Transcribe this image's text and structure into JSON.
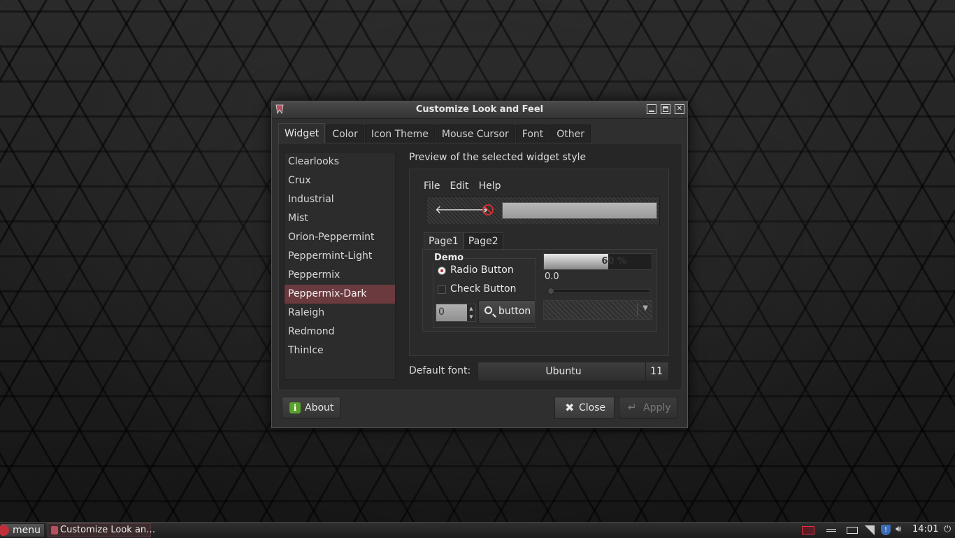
{
  "window": {
    "title": "Customize Look and Feel",
    "tabs": [
      "Widget",
      "Color",
      "Icon Theme",
      "Mouse Cursor",
      "Font",
      "Other"
    ],
    "active_tab": "Widget"
  },
  "themes": {
    "items": [
      "Clearlooks",
      "Crux",
      "Industrial",
      "Mist",
      "Orion-Peppermint",
      "Peppermint-Light",
      "Peppermix",
      "Peppermix-Dark",
      "Raleigh",
      "Redmond",
      "ThinIce"
    ],
    "selected": "Peppermix-Dark"
  },
  "preview": {
    "label": "Preview of the selected widget style",
    "menu": [
      "File",
      "Edit",
      "Help"
    ],
    "tabs": [
      "Page1",
      "Page2"
    ],
    "demo_label": "Demo",
    "radio_label": "Radio Button",
    "check_label": "Check Button",
    "spin_value": "0",
    "button_label": "button",
    "progress_text": "60 %",
    "progress_fraction": 0.6,
    "range_value": "0.0"
  },
  "font": {
    "label": "Default font:",
    "name": "Ubuntu",
    "size": "11"
  },
  "buttons": {
    "about": "About",
    "close": "Close",
    "apply": "Apply"
  },
  "taskbar": {
    "menu_label": "menu",
    "task_title": "Customize Look an…",
    "clock": "14:01"
  },
  "colors": {
    "accent": "#6b3a3e",
    "stop_red": "#d23030"
  }
}
